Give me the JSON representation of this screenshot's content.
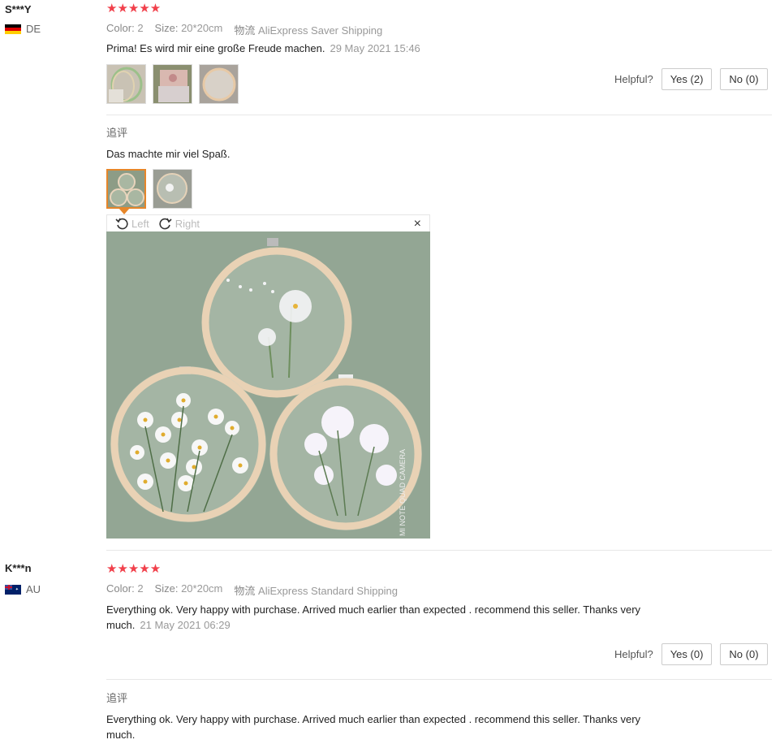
{
  "reviews": [
    {
      "user": "S***Y",
      "country": "DE",
      "stars": "★★★★★",
      "color_label": "Color:",
      "color_value": "2",
      "size_label": "Size:",
      "size_value": "20*20cm",
      "shipping_label": "物流",
      "shipping_value": "AliExpress Saver Shipping",
      "text": "Prima! Es wird mir eine große Freude machen.",
      "date": "29 May 2021 15:46",
      "helpful_label": "Helpful?",
      "yes_label": "Yes (2)",
      "no_label": "No (0)",
      "followup_label": "追评",
      "followup_text": "Das machte mir viel Spaß."
    },
    {
      "user": "K***n",
      "country": "AU",
      "stars": "★★★★★",
      "color_label": "Color:",
      "color_value": "2",
      "size_label": "Size:",
      "size_value": "20*20cm",
      "shipping_label": "物流",
      "shipping_value": "AliExpress Standard Shipping",
      "text": "Everything ok. Very happy with purchase. Arrived much earlier than expected . recommend this seller.  Thanks very much.",
      "date": "21 May 2021 06:29",
      "helpful_label": "Helpful?",
      "yes_label": "Yes (0)",
      "no_label": "No (0)",
      "followup_label": "追评",
      "followup_text": "Everything ok. Very happy with purchase. Arrived much earlier than expected . recommend this seller.  Thanks very much."
    }
  ],
  "viewer": {
    "rotate_left": "Left",
    "rotate_right": "Right",
    "close": "×",
    "watermark": "MI NOTE QUAD CAMERA"
  }
}
